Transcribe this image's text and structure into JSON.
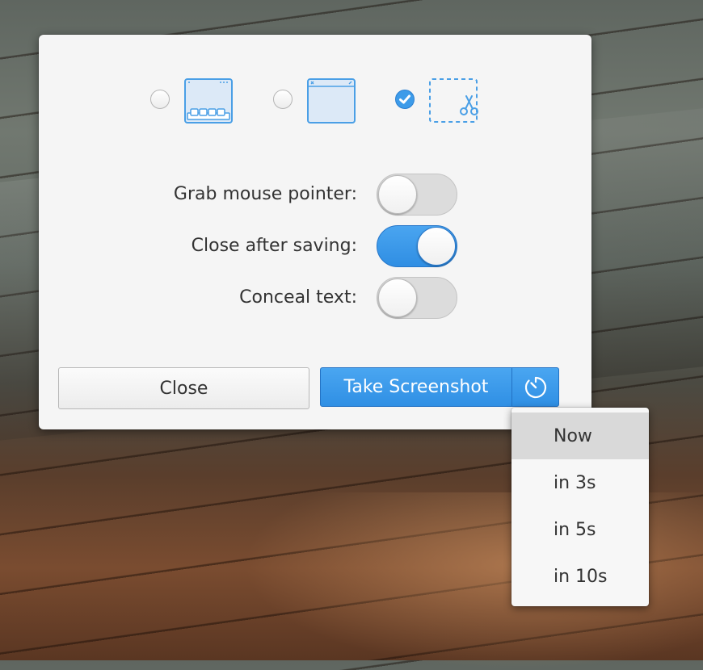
{
  "capture_modes": [
    {
      "name": "entire-screen",
      "selected": false,
      "icon": "screen-icon"
    },
    {
      "name": "current-window",
      "selected": false,
      "icon": "window-icon"
    },
    {
      "name": "select-area",
      "selected": true,
      "icon": "selection-scissors-icon"
    }
  ],
  "options": [
    {
      "label": "Grab mouse pointer:",
      "on": false
    },
    {
      "label": "Close after saving:",
      "on": true
    },
    {
      "label": "Conceal text:",
      "on": false
    }
  ],
  "buttons": {
    "close_label": "Close",
    "take_label": "Take Screenshot",
    "delay_icon": "timer-icon"
  },
  "delay_menu": {
    "items": [
      "Now",
      "in 3s",
      "in 5s",
      "in 10s"
    ],
    "selected": "Now"
  },
  "colors": {
    "accent": "#3d9be9",
    "icon_blue": "#4a9fe6"
  }
}
